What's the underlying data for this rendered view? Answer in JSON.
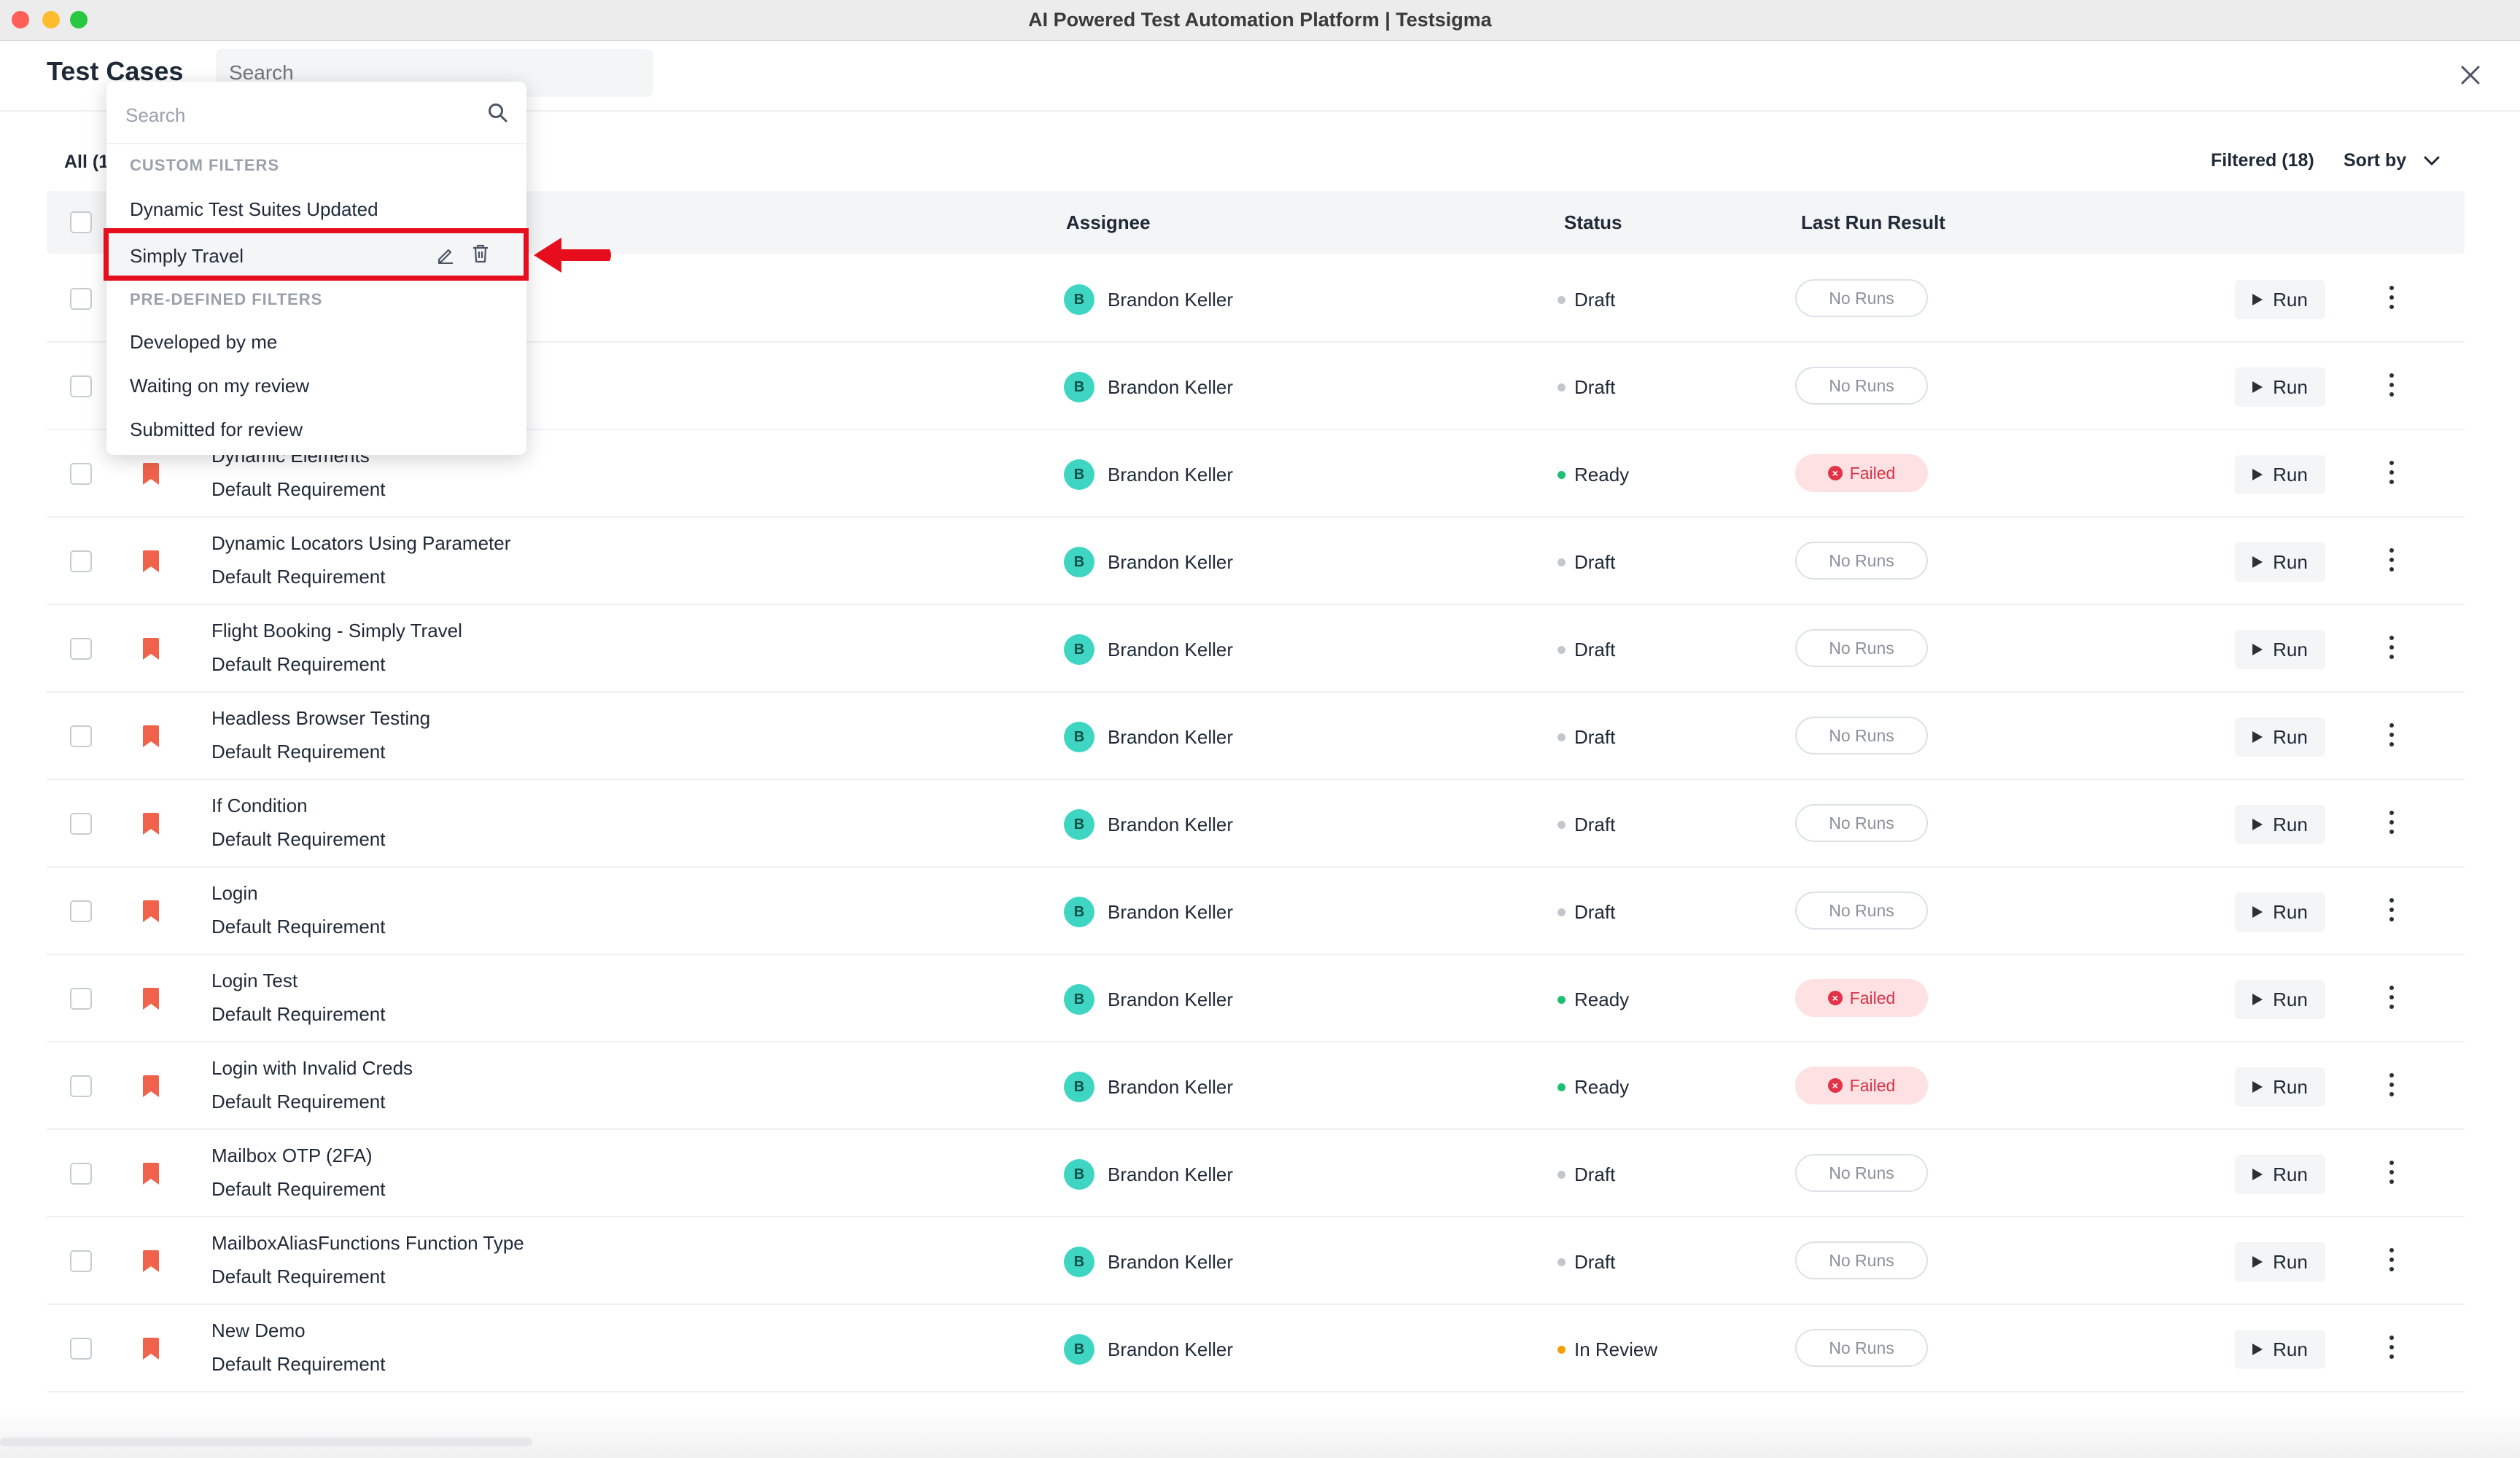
{
  "window": {
    "title": "AI Powered Test Automation Platform | Testsigma"
  },
  "header": {
    "title": "Test Cases",
    "search_placeholder": "Search"
  },
  "toolbar": {
    "all_label": "All (1",
    "filtered_label": "Filtered (18)",
    "sort_label": "Sort by"
  },
  "table": {
    "headers": {
      "assignee": "Assignee",
      "status": "Status",
      "last_run": "Last Run Result"
    }
  },
  "dropdown": {
    "search_placeholder": "Search",
    "custom_title": "CUSTOM FILTERS",
    "custom_items": [
      "Dynamic Test Suites Updated",
      "Simply Travel"
    ],
    "predefined_title": "PRE-DEFINED FILTERS",
    "predefined_items": [
      "Developed by me",
      "Waiting on my review",
      "Submitted for review"
    ]
  },
  "rows": [
    {
      "name": "",
      "requirement": "",
      "assignee": "Brandon Keller",
      "avatar": "B",
      "status": "Draft",
      "status_color": "#c3c7cd",
      "result": "No Runs",
      "failed": false,
      "run": "Run"
    },
    {
      "name": "",
      "requirement": "",
      "assignee": "Brandon Keller",
      "avatar": "B",
      "status": "Draft",
      "status_color": "#c3c7cd",
      "result": "No Runs",
      "failed": false,
      "run": "Run"
    },
    {
      "name": "Dynamic Elements",
      "requirement": "Default Requirement",
      "assignee": "Brandon Keller",
      "avatar": "B",
      "status": "Ready",
      "status_color": "#1dbf73",
      "result": "Failed",
      "failed": true,
      "run": "Run"
    },
    {
      "name": "Dynamic Locators Using Parameter",
      "requirement": "Default Requirement",
      "assignee": "Brandon Keller",
      "avatar": "B",
      "status": "Draft",
      "status_color": "#c3c7cd",
      "result": "No Runs",
      "failed": false,
      "run": "Run"
    },
    {
      "name": "Flight Booking - Simply Travel",
      "requirement": "Default Requirement",
      "assignee": "Brandon Keller",
      "avatar": "B",
      "status": "Draft",
      "status_color": "#c3c7cd",
      "result": "No Runs",
      "failed": false,
      "run": "Run"
    },
    {
      "name": "Headless Browser Testing",
      "requirement": "Default Requirement",
      "assignee": "Brandon Keller",
      "avatar": "B",
      "status": "Draft",
      "status_color": "#c3c7cd",
      "result": "No Runs",
      "failed": false,
      "run": "Run"
    },
    {
      "name": "If Condition",
      "requirement": "Default Requirement",
      "assignee": "Brandon Keller",
      "avatar": "B",
      "status": "Draft",
      "status_color": "#c3c7cd",
      "result": "No Runs",
      "failed": false,
      "run": "Run"
    },
    {
      "name": "Login",
      "requirement": "Default Requirement",
      "assignee": "Brandon Keller",
      "avatar": "B",
      "status": "Draft",
      "status_color": "#c3c7cd",
      "result": "No Runs",
      "failed": false,
      "run": "Run"
    },
    {
      "name": "Login Test",
      "requirement": "Default Requirement",
      "assignee": "Brandon Keller",
      "avatar": "B",
      "status": "Ready",
      "status_color": "#1dbf73",
      "result": "Failed",
      "failed": true,
      "run": "Run"
    },
    {
      "name": "Login with Invalid Creds",
      "requirement": "Default Requirement",
      "assignee": "Brandon Keller",
      "avatar": "B",
      "status": "Ready",
      "status_color": "#1dbf73",
      "result": "Failed",
      "failed": true,
      "run": "Run"
    },
    {
      "name": "Mailbox OTP (2FA)",
      "requirement": "Default Requirement",
      "assignee": "Brandon Keller",
      "avatar": "B",
      "status": "Draft",
      "status_color": "#c3c7cd",
      "result": "No Runs",
      "failed": false,
      "run": "Run"
    },
    {
      "name": "MailboxAliasFunctions Function Type",
      "requirement": "Default Requirement",
      "assignee": "Brandon Keller",
      "avatar": "B",
      "status": "Draft",
      "status_color": "#c3c7cd",
      "result": "No Runs",
      "failed": false,
      "run": "Run"
    },
    {
      "name": "New Demo",
      "requirement": "Default Requirement",
      "assignee": "Brandon Keller",
      "avatar": "B",
      "status": "In Review",
      "status_color": "#f59e0b",
      "result": "No Runs",
      "failed": false,
      "run": "Run"
    }
  ]
}
